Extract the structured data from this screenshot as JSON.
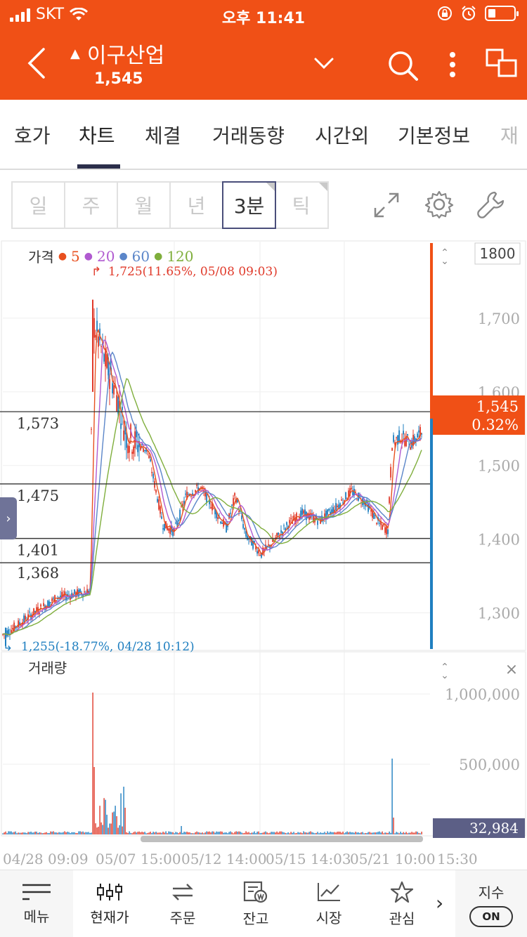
{
  "status_bar": {
    "carrier": "SKT",
    "time": "오후 11:41"
  },
  "header": {
    "stock_name": "이구산업",
    "direction": "▲",
    "price": "1,545"
  },
  "tabs": [
    {
      "label": "호가"
    },
    {
      "label": "차트",
      "active": true
    },
    {
      "label": "체결"
    },
    {
      "label": "거래동향"
    },
    {
      "label": "시간외"
    },
    {
      "label": "기본정보"
    },
    {
      "label": "재"
    }
  ],
  "periods": [
    {
      "label": "일"
    },
    {
      "label": "주"
    },
    {
      "label": "월"
    },
    {
      "label": "년"
    },
    {
      "label": "3분",
      "active": true
    },
    {
      "label": "틱"
    }
  ],
  "icons": {
    "back": "chevron-left-icon",
    "dropdown": "chevron-down-icon",
    "search": "search-icon",
    "more": "more-vertical-icon",
    "windows": "multi-window-icon",
    "expand": "expand-icon",
    "settings": "gear-icon",
    "tools": "wrench-icon"
  },
  "colors": {
    "accent": "#f05016",
    "ma5": "#e8501f",
    "ma20": "#b05ad0",
    "ma60": "#5b86c9",
    "ma120": "#7fae3c",
    "down": "#1f7fc0",
    "up": "#e03a2a"
  },
  "chart": {
    "price_title": "가격",
    "legend": [
      {
        "label": "5",
        "color": "#e8501f"
      },
      {
        "label": "20",
        "color": "#b05ad0"
      },
      {
        "label": "60",
        "color": "#5b86c9"
      },
      {
        "label": "120",
        "color": "#7fae3c"
      }
    ],
    "scale_label": "1800",
    "high_annotation": "1,725(11.65%, 05/08 09:03)",
    "low_annotation": "1,255(-18.77%, 04/28 10:12)",
    "current_price": "1,545",
    "current_change": "0.32%",
    "current_volume": "32,984",
    "volume_title": "거래량",
    "price_axis": [
      "1,700",
      "1,600",
      "1,500",
      "1,400",
      "1,300"
    ],
    "volume_axis": [
      "1,000,000",
      "500,000"
    ],
    "level_lines": [
      "1,573",
      "1,475",
      "1,401",
      "1,368"
    ],
    "x_labels": [
      "04/28 09:09",
      "05/07 15:00",
      "05/12 14:00",
      "05/15 14:03",
      "05/21 10:00",
      "15:30"
    ]
  },
  "chart_data": {
    "type": "line",
    "title": "",
    "x": [
      "04/28 09:09",
      "05/07 15:00",
      "05/08 09:03",
      "05/12 14:00",
      "05/15 14:03",
      "05/21 10:00",
      "15:30"
    ],
    "series": [
      {
        "name": "가격",
        "values": [
          1270,
          1335,
          1725,
          1470,
          1380,
          1440,
          1545
        ]
      }
    ],
    "ylim": [
      1250,
      1800
    ],
    "high": 1725,
    "low": 1255,
    "volume_ylim": [
      0,
      1200000
    ],
    "volume_spike_values": [
      1010000,
      540000,
      32984
    ]
  },
  "bottom_nav": {
    "items": [
      {
        "label": "메뉴",
        "icon": "menu-icon"
      },
      {
        "label": "현재가",
        "icon": "price-icon"
      },
      {
        "label": "주문",
        "icon": "swap-icon"
      },
      {
        "label": "잔고",
        "icon": "balance-icon"
      },
      {
        "label": "시장",
        "icon": "trend-icon"
      },
      {
        "label": "관심",
        "icon": "star-icon"
      }
    ],
    "index_label": "지수",
    "index_toggle": "ON"
  }
}
